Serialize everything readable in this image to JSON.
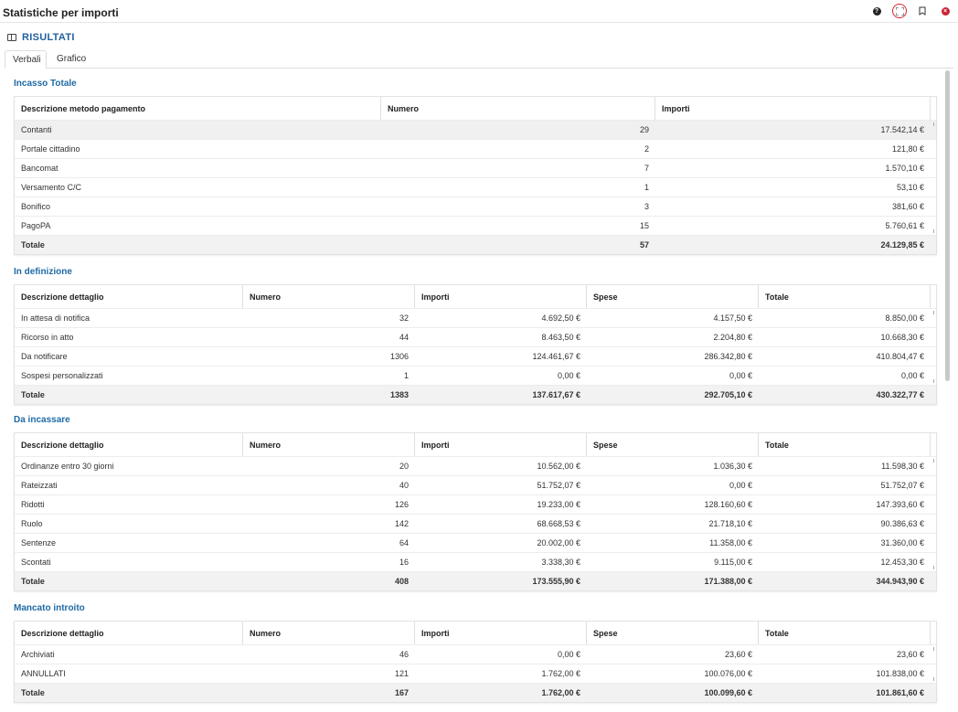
{
  "window": {
    "title": "Statistiche per importi"
  },
  "section": {
    "label": "RISULTATI"
  },
  "tabs": [
    {
      "label": "Verbali"
    },
    {
      "label": "Grafico"
    }
  ],
  "incasso": {
    "title": "Incasso Totale",
    "headers": [
      "Descrizione metodo pagamento",
      "Numero",
      "Importi"
    ],
    "rows": [
      [
        "Contanti",
        "29",
        "17.542,14 €"
      ],
      [
        "Portale cittadino",
        "2",
        "121,80 €"
      ],
      [
        "Bancomat",
        "7",
        "1.570,10 €"
      ],
      [
        "Versamento C/C",
        "1",
        "53,10 €"
      ],
      [
        "Bonifico",
        "3",
        "381,60 €"
      ],
      [
        "PagoPA",
        "15",
        "5.760,61 €"
      ]
    ],
    "total": [
      "Totale",
      "57",
      "24.129,85 €"
    ]
  },
  "definizione": {
    "title": "In definizione",
    "headers": [
      "Descrizione dettaglio",
      "Numero",
      "Importi",
      "Spese",
      "Totale"
    ],
    "rows": [
      [
        "In attesa di notifica",
        "32",
        "4.692,50 €",
        "4.157,50 €",
        "8.850,00 €"
      ],
      [
        "Ricorso in atto",
        "44",
        "8.463,50 €",
        "2.204,80 €",
        "10.668,30 €"
      ],
      [
        "Da notificare",
        "1306",
        "124.461,67 €",
        "286.342,80 €",
        "410.804,47 €"
      ],
      [
        "Sospesi personalizzati",
        "1",
        "0,00 €",
        "0,00 €",
        "0,00 €"
      ]
    ],
    "total": [
      "Totale",
      "1383",
      "137.617,67 €",
      "292.705,10 €",
      "430.322,77 €"
    ]
  },
  "incassare": {
    "title": "Da incassare",
    "headers": [
      "Descrizione dettaglio",
      "Numero",
      "Importi",
      "Spese",
      "Totale"
    ],
    "rows": [
      [
        "Ordinanze entro 30 giorni",
        "20",
        "10.562,00 €",
        "1.036,30 €",
        "11.598,30 €"
      ],
      [
        "Rateizzati",
        "40",
        "51.752,07 €",
        "0,00 €",
        "51.752,07 €"
      ],
      [
        "Ridotti",
        "126",
        "19.233,00 €",
        "128.160,60 €",
        "147.393,60 €"
      ],
      [
        "Ruolo",
        "142",
        "68.668,53 €",
        "21.718,10 €",
        "90.386,63 €"
      ],
      [
        "Sentenze",
        "64",
        "20.002,00 €",
        "11.358,00 €",
        "31.360,00 €"
      ],
      [
        "Scontati",
        "16",
        "3.338,30 €",
        "9.115,00 €",
        "12.453,30 €"
      ]
    ],
    "total": [
      "Totale",
      "408",
      "173.555,90 €",
      "171.388,00 €",
      "344.943,90 €"
    ]
  },
  "mancato": {
    "title": "Mancato introito",
    "headers": [
      "Descrizione dettaglio",
      "Numero",
      "Importi",
      "Spese",
      "Totale"
    ],
    "rows": [
      [
        "Archiviati",
        "46",
        "0,00 €",
        "23,60 €",
        "23,60 €"
      ],
      [
        "ANNULLATI",
        "121",
        "1.762,00 €",
        "100.076,00 €",
        "101.838,00 €"
      ]
    ],
    "total": [
      "Totale",
      "167",
      "1.762,00 €",
      "100.099,60 €",
      "101.861,60 €"
    ]
  }
}
